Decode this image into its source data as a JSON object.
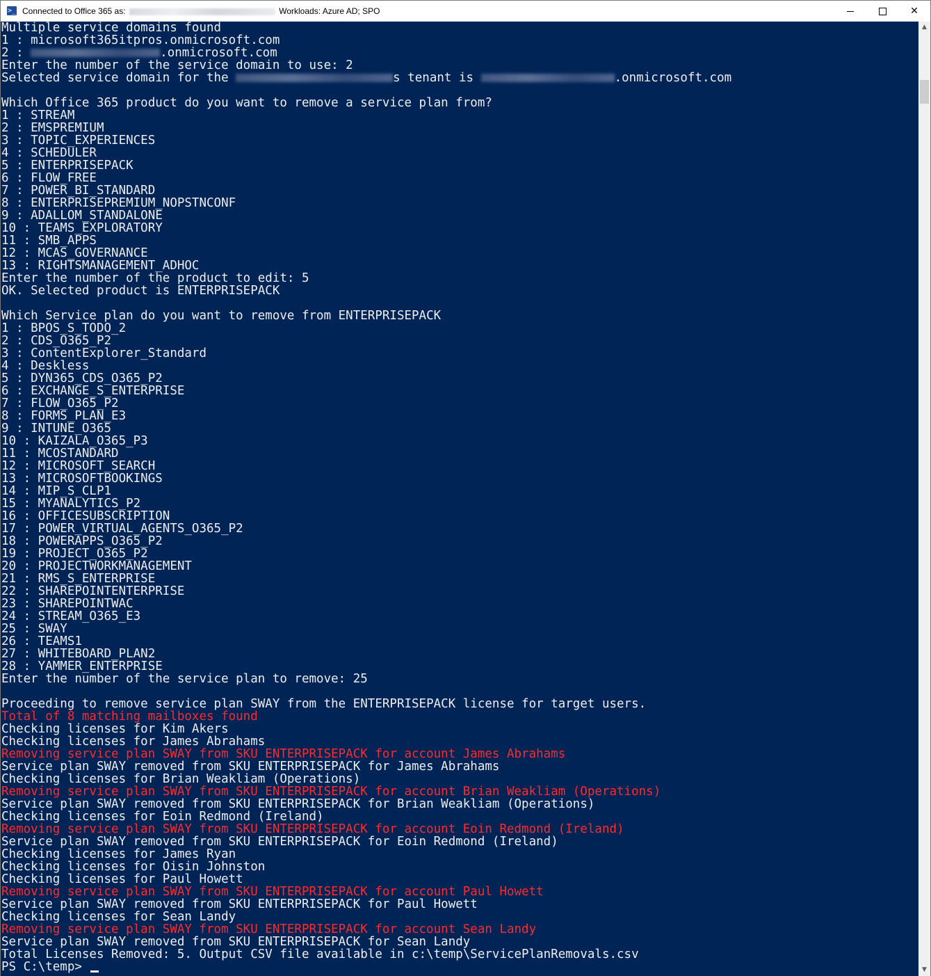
{
  "window": {
    "title_prefix": "Connected to Office 365 as:",
    "title_suffix": "Workloads: Azure AD; SPO",
    "app_icon_glyph": ">_",
    "controls": {
      "minimize": "minimize",
      "maximize": "maximize",
      "close": "✕"
    }
  },
  "console": {
    "background": "#012456",
    "text_color": "#eeedf0",
    "error_color": "#ff2a2a",
    "lines": [
      {
        "text": "Multiple service domains found"
      },
      {
        "text": "1 : microsoft365itpros.onmicrosoft.com"
      },
      {
        "text": "2 : ",
        "redacted": true,
        "after": ".onmicrosoft.com"
      },
      {
        "text": "Enter the number of the service domain to use: 2"
      },
      {
        "text": "Selected service domain for the ",
        "redacted": true,
        "after": "s tenant is ",
        "redacted2": true,
        "after2": ".onmicrosoft.com"
      },
      {
        "text": ""
      },
      {
        "text": "Which Office 365 product do you want to remove a service plan from?"
      },
      {
        "text": "1 : STREAM"
      },
      {
        "text": "2 : EMSPREMIUM"
      },
      {
        "text": "3 : TOPIC_EXPERIENCES"
      },
      {
        "text": "4 : SCHEDULER"
      },
      {
        "text": "5 : ENTERPRISEPACK"
      },
      {
        "text": "6 : FLOW_FREE"
      },
      {
        "text": "7 : POWER_BI_STANDARD"
      },
      {
        "text": "8 : ENTERPRISEPREMIUM_NOPSTNCONF"
      },
      {
        "text": "9 : ADALLOM_STANDALONE"
      },
      {
        "text": "10 : TEAMS_EXPLORATORY"
      },
      {
        "text": "11 : SMB_APPS"
      },
      {
        "text": "12 : MCAS_GOVERNANCE"
      },
      {
        "text": "13 : RIGHTSMANAGEMENT_ADHOC"
      },
      {
        "text": "Enter the number of the product to edit: 5"
      },
      {
        "text": "OK. Selected product is ENTERPRISEPACK"
      },
      {
        "text": ""
      },
      {
        "text": "Which Service plan do you want to remove from ENTERPRISEPACK"
      },
      {
        "text": "1 : BPOS_S_TODO_2"
      },
      {
        "text": "2 : CDS_O365_P2"
      },
      {
        "text": "3 : ContentExplorer_Standard"
      },
      {
        "text": "4 : Deskless"
      },
      {
        "text": "5 : DYN365_CDS_O365_P2"
      },
      {
        "text": "6 : EXCHANGE_S_ENTERPRISE"
      },
      {
        "text": "7 : FLOW_O365_P2"
      },
      {
        "text": "8 : FORMS_PLAN_E3"
      },
      {
        "text": "9 : INTUNE_O365"
      },
      {
        "text": "10 : KAIZALA_O365_P3"
      },
      {
        "text": "11 : MCOSTANDARD"
      },
      {
        "text": "12 : MICROSOFT_SEARCH"
      },
      {
        "text": "13 : MICROSOFTBOOKINGS"
      },
      {
        "text": "14 : MIP_S_CLP1"
      },
      {
        "text": "15 : MYANALYTICS_P2"
      },
      {
        "text": "16 : OFFICESUBSCRIPTION"
      },
      {
        "text": "17 : POWER_VIRTUAL_AGENTS_O365_P2"
      },
      {
        "text": "18 : POWERAPPS_O365_P2"
      },
      {
        "text": "19 : PROJECT_O365_P2"
      },
      {
        "text": "20 : PROJECTWORKMANAGEMENT"
      },
      {
        "text": "21 : RMS_S_ENTERPRISE"
      },
      {
        "text": "22 : SHAREPOINTENTERPRISE"
      },
      {
        "text": "23 : SHAREPOINTWAC"
      },
      {
        "text": "24 : STREAM_O365_E3"
      },
      {
        "text": "25 : SWAY"
      },
      {
        "text": "26 : TEAMS1"
      },
      {
        "text": "27 : WHITEBOARD_PLAN2"
      },
      {
        "text": "28 : YAMMER_ENTERPRISE"
      },
      {
        "text": "Enter the number of the service plan to remove: 25"
      },
      {
        "text": ""
      },
      {
        "text": "Proceeding to remove service plan SWAY from the ENTERPRISEPACK license for target users."
      },
      {
        "text": "Total of 8 matching mailboxes found",
        "error": true
      },
      {
        "text": "Checking licenses for Kim Akers"
      },
      {
        "text": "Checking licenses for James Abrahams"
      },
      {
        "text": "Removing service plan SWAY from SKU ENTERPRISEPACK for account James Abrahams",
        "error": true
      },
      {
        "text": "Service plan SWAY removed from SKU ENTERPRISEPACK for James Abrahams"
      },
      {
        "text": "Checking licenses for Brian Weakliam (Operations)"
      },
      {
        "text": "Removing service plan SWAY from SKU ENTERPRISEPACK for account Brian Weakliam (Operations)",
        "error": true
      },
      {
        "text": "Service plan SWAY removed from SKU ENTERPRISEPACK for Brian Weakliam (Operations)"
      },
      {
        "text": "Checking licenses for Eoin Redmond (Ireland)"
      },
      {
        "text": "Removing service plan SWAY from SKU ENTERPRISEPACK for account Eoin Redmond (Ireland)",
        "error": true
      },
      {
        "text": "Service plan SWAY removed from SKU ENTERPRISEPACK for Eoin Redmond (Ireland)"
      },
      {
        "text": "Checking licenses for James Ryan"
      },
      {
        "text": "Checking licenses for Oisin Johnston"
      },
      {
        "text": "Checking licenses for Paul Howett"
      },
      {
        "text": "Removing service plan SWAY from SKU ENTERPRISEPACK for account Paul Howett",
        "error": true
      },
      {
        "text": "Service plan SWAY removed from SKU ENTERPRISEPACK for Paul Howett"
      },
      {
        "text": "Checking licenses for Sean Landy"
      },
      {
        "text": "Removing service plan SWAY from SKU ENTERPRISEPACK for account Sean Landy",
        "error": true
      },
      {
        "text": "Service plan SWAY removed from SKU ENTERPRISEPACK for Sean Landy"
      },
      {
        "text": "Total Licenses Removed: 5. Output CSV file available in c:\\temp\\ServicePlanRemovals.csv"
      },
      {
        "text": "PS C:\\temp> ",
        "prompt": true
      }
    ]
  },
  "scrollbar": {
    "up_arrow": "▲",
    "down_arrow": "▼"
  }
}
